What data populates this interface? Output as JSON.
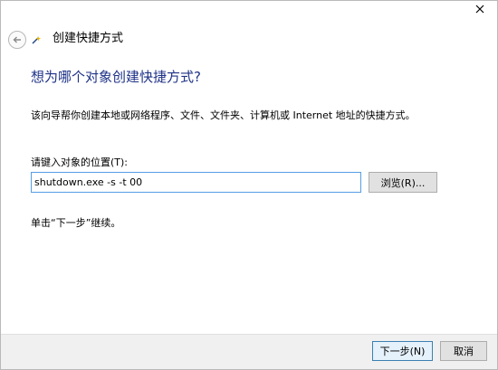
{
  "window": {
    "title": "创建快捷方式"
  },
  "page": {
    "heading": "想为哪个对象创建快捷方式?",
    "description": "该向导帮你创建本地或网络程序、文件、文件夹、计算机或 Internet 地址的快捷方式。",
    "location_label": "请键入对象的位置(T):",
    "location_value": "shutdown.exe -s -t 00",
    "browse_label": "浏览(R)...",
    "hint": "单击“下一步”继续。"
  },
  "footer": {
    "next_label": "下一步(N)",
    "cancel_label": "取消"
  },
  "icons": {
    "close": "close-icon",
    "back": "back-arrow-icon",
    "wizard": "shortcut-wizard-icon"
  },
  "colors": {
    "heading": "#1e3287",
    "input_border": "#569de5",
    "footer_bg": "#f0f0f0",
    "default_button_border": "#3c7fb1"
  }
}
